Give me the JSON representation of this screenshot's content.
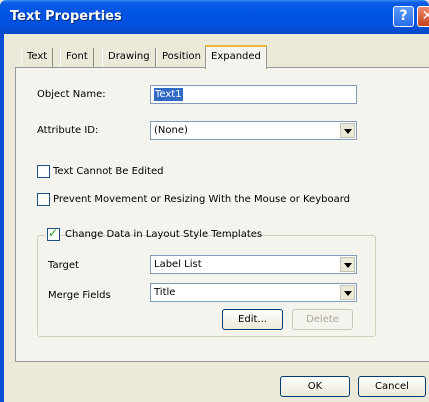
{
  "window": {
    "title": "Text Properties",
    "help_glyph": "?",
    "close_glyph": "✕"
  },
  "tabs": [
    {
      "label": "Text"
    },
    {
      "label": "Font"
    },
    {
      "label": "Drawing"
    },
    {
      "label": "Position"
    },
    {
      "label": "Expanded",
      "active": true
    }
  ],
  "form": {
    "object_name_label": "Object Name:",
    "object_name_value": "Text1",
    "attribute_id_label": "Attribute ID:",
    "attribute_id_value": "(None)",
    "text_cannot_be_edited_label": "Text Cannot Be Edited",
    "text_cannot_be_edited_checked": false,
    "prevent_movement_label": "Prevent Movement or Resizing With the Mouse or Keyboard",
    "prevent_movement_checked": false
  },
  "group": {
    "label": "Change Data in Layout Style Templates",
    "checked": true,
    "target_label": "Target",
    "target_value": "Label List",
    "merge_fields_label": "Merge Fields",
    "merge_fields_value": "Title",
    "edit_button": "Edit...",
    "delete_button": "Delete"
  },
  "footer": {
    "ok_button": "OK",
    "cancel_button": "Cancel"
  },
  "colors": {
    "titlebar": "#0054e3",
    "dialog_bg": "#ece9d8",
    "panel_bg": "#f4f3ee",
    "selection": "#316ac5",
    "check": "#21a121"
  }
}
